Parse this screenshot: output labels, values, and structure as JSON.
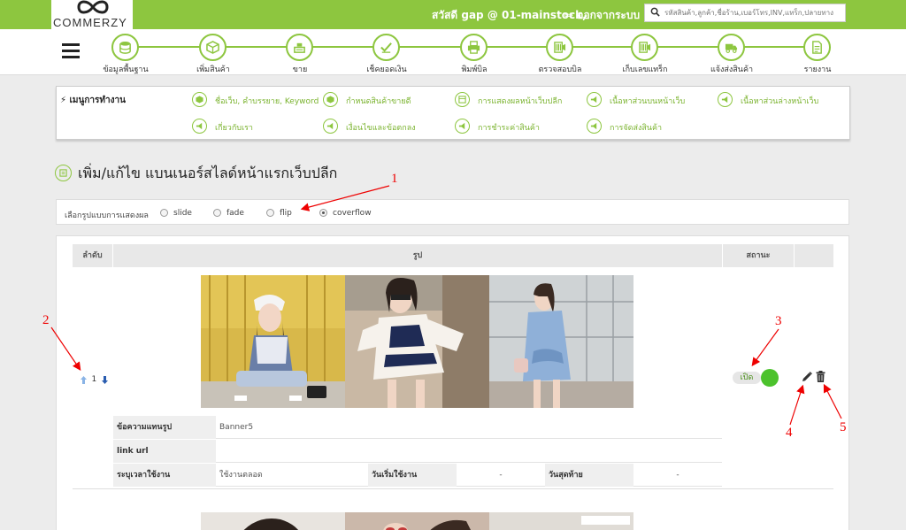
{
  "topbar": {
    "logo_text": "COMMERZY",
    "greeting": "สวัสดี gap @ 01-mainstock,",
    "logout_label": "ออกจากระบบ",
    "search_placeholder": "รหัสสินค้า,ลูกค้า,ชื่อร้าน,เบอร์โทร,INV,แทร็ก,ปลายทาง",
    "accent": "#8dc63f"
  },
  "steps": [
    {
      "label": "ข้อมูลพื้นฐาน",
      "icon": "database-icon"
    },
    {
      "label": "เพิ่มสินค้า",
      "icon": "box-icon"
    },
    {
      "label": "ขาย",
      "icon": "cash-register-icon"
    },
    {
      "label": "เช็คยอดเงิน",
      "icon": "check-money-icon"
    },
    {
      "label": "พิมพ์บิล",
      "icon": "printer-icon"
    },
    {
      "label": "ตรวจสอบบิล",
      "icon": "barcode-scan-icon"
    },
    {
      "label": "เก็บเลขแทร็ก",
      "icon": "barcode-scan-icon"
    },
    {
      "label": "แจ้งส่งสินค้า",
      "icon": "truck-icon"
    },
    {
      "label": "รายงาน",
      "icon": "report-icon"
    }
  ],
  "menu": {
    "title": "เมนูการทำงาน",
    "items": [
      {
        "label": "ชื่อเว็บ, คำบรรยาย, Keyword",
        "icon": "box-icon"
      },
      {
        "label": "กำหนดสินค้าขายดี",
        "icon": "box-icon"
      },
      {
        "label": "การแสดงผลหน้าเว็บปลีก",
        "icon": "layout-icon"
      },
      {
        "label": "เนื้อหาส่วนบนหน้าเว็บ",
        "icon": "megaphone-icon"
      },
      {
        "label": "เนื้อหาส่วนล่างหน้าเว็บ",
        "icon": "megaphone-icon"
      },
      {
        "label": "เกี่ยวกับเรา",
        "icon": "megaphone-icon"
      },
      {
        "label": "เงื่อนไขและข้อตกลง",
        "icon": "megaphone-icon"
      },
      {
        "label": "การชำระค่าสินค้า",
        "icon": "megaphone-icon"
      },
      {
        "label": "การจัดส่งสินค้า",
        "icon": "megaphone-icon"
      }
    ]
  },
  "page": {
    "title": "เพิ่ม/แก้ไข แบนเนอร์สไลด์หน้าแรกเว็บปลีก"
  },
  "display_mode": {
    "label": "เลือกรูปแบบการแสดงผล",
    "options": [
      "slide",
      "fade",
      "flip",
      "coverflow"
    ],
    "selected": "coverflow"
  },
  "table": {
    "headers": {
      "order": "ลำดับ",
      "image": "รูป",
      "status": "สถานะ"
    },
    "row": {
      "order": "1",
      "alt_label": "ข้อความแทนรูป",
      "alt_value": "Banner5",
      "link_label": "link url",
      "link_value": "",
      "time_label": "ระบุเวลาใช้งาน",
      "time_value": "ใช้งานตลอด",
      "start_label": "วันเริ่มใช้งาน",
      "start_value": "-",
      "end_label": "วันสุดท้าย",
      "end_value": "-",
      "status": "เปิด",
      "status_color": "#4cc22c"
    }
  },
  "annotations": [
    "1",
    "2",
    "3",
    "4",
    "5"
  ]
}
